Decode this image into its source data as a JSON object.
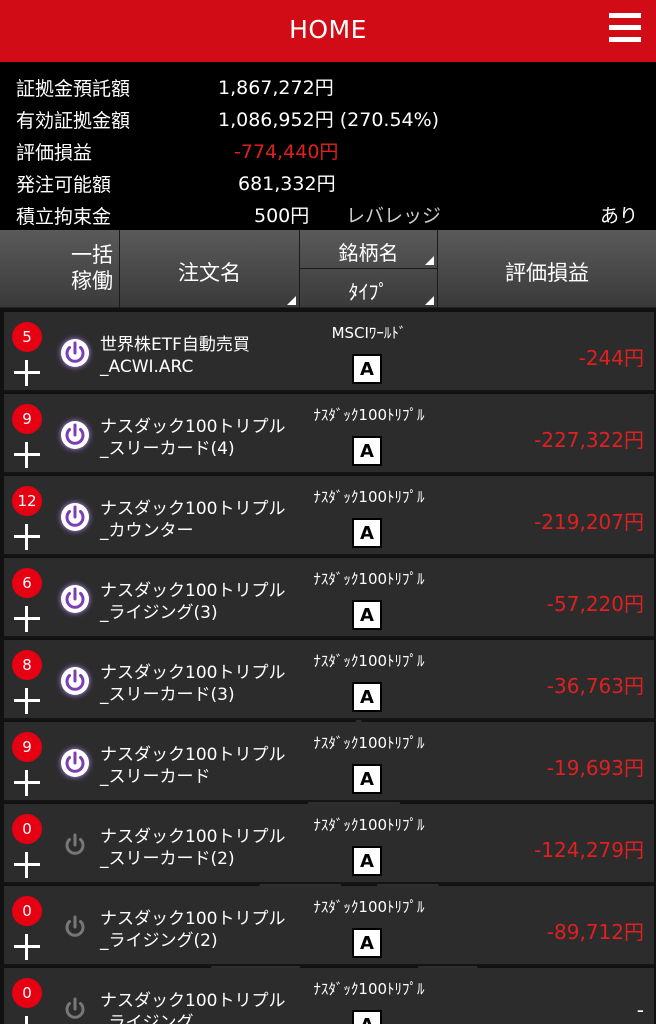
{
  "header": {
    "title": "HOME",
    "menu_icon": "hamburger-menu-icon"
  },
  "summary": {
    "margin_deposit_label": "証拠金預託額",
    "margin_deposit": "1,867,272円",
    "effective_margin_label": "有効証拠金額",
    "effective_margin": "1,086,952円 (270.54%)",
    "unrealized_pl_label": "評価損益",
    "unrealized_pl": "-774,440円",
    "orderable_label": "発注可能額",
    "orderable": "681,332円",
    "reserve_label": "積立拘束金",
    "reserve": "500円",
    "leverage_label": "レバレッジ",
    "leverage": "あり"
  },
  "columns": {
    "bulk_line1": "一括",
    "bulk_line2": "稼働",
    "order_name": "注文名",
    "symbol": "銘柄名",
    "type": "ﾀｲﾌﾟ",
    "pl": "評価損益"
  },
  "colors": {
    "brand_red": "#d20c17",
    "negative": "#e02020",
    "active_power": "#7a3fb5"
  },
  "orders": [
    {
      "count": "5",
      "line1": "世界株ETF自動売買",
      "line2": "_ACWI.ARC",
      "symbol": "MSCIﾜｰﾙﾄﾞ",
      "type": "A",
      "pl": "-244円",
      "active": true
    },
    {
      "count": "9",
      "line1": "ナスダック100トリプル",
      "line2": "_スリーカード(4)",
      "symbol": "ﾅｽﾀﾞｯｸ100ﾄﾘﾌﾟﾙ",
      "type": "A",
      "pl": "-227,322円",
      "active": true
    },
    {
      "count": "12",
      "line1": "ナスダック100トリプル",
      "line2": "_カウンター",
      "symbol": "ﾅｽﾀﾞｯｸ100ﾄﾘﾌﾟﾙ",
      "type": "A",
      "pl": "-219,207円",
      "active": true
    },
    {
      "count": "6",
      "line1": "ナスダック100トリプル",
      "line2": "_ライジング(3)",
      "symbol": "ﾅｽﾀﾞｯｸ100ﾄﾘﾌﾟﾙ",
      "type": "A",
      "pl": "-57,220円",
      "active": true
    },
    {
      "count": "8",
      "line1": "ナスダック100トリプル",
      "line2": "_スリーカード(3)",
      "symbol": "ﾅｽﾀﾞｯｸ100ﾄﾘﾌﾟﾙ",
      "type": "A",
      "pl": "-36,763円",
      "active": true
    },
    {
      "count": "9",
      "line1": "ナスダック100トリプル",
      "line2": "_スリーカード",
      "symbol": "ﾅｽﾀﾞｯｸ100ﾄﾘﾌﾟﾙ",
      "type": "A",
      "pl": "-19,693円",
      "active": true
    },
    {
      "count": "0",
      "line1": "ナスダック100トリプル",
      "line2": "_スリーカード(2)",
      "symbol": "ﾅｽﾀﾞｯｸ100ﾄﾘﾌﾟﾙ",
      "type": "A",
      "pl": "-124,279円",
      "active": false
    },
    {
      "count": "0",
      "line1": "ナスダック100トリプル",
      "line2": "_ライジング(2)",
      "symbol": "ﾅｽﾀﾞｯｸ100ﾄﾘﾌﾟﾙ",
      "type": "A",
      "pl": "-89,712円",
      "active": false
    },
    {
      "count": "0",
      "line1": "ナスダック100トリプル",
      "line2": "_ライジング",
      "symbol": "ﾅｽﾀﾞｯｸ100ﾄﾘﾌﾟﾙ",
      "type": "A",
      "pl": "-",
      "active": false
    }
  ]
}
